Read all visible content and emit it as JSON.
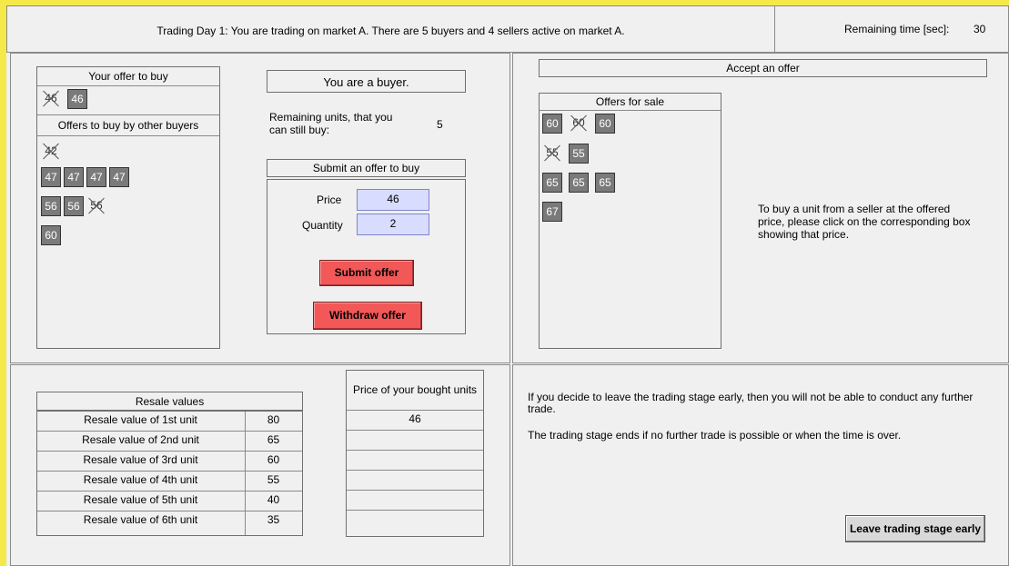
{
  "header": {
    "message": "Trading Day 1: You are trading on market A. There are 5 buyers and 4 sellers active on market A.",
    "remaining_label": "Remaining time [sec]:",
    "remaining_value": "30"
  },
  "buy_panel": {
    "your_offer_title": "Your offer to buy",
    "your_offers": [
      {
        "value": "46",
        "withdrawn": true
      },
      {
        "value": "46",
        "withdrawn": false
      }
    ],
    "other_offers_title": "Offers to buy by other buyers",
    "other_offers_rows": [
      [
        {
          "value": "42",
          "withdrawn": true
        }
      ],
      [
        {
          "value": "47",
          "withdrawn": false
        },
        {
          "value": "47",
          "withdrawn": false
        },
        {
          "value": "47",
          "withdrawn": false
        },
        {
          "value": "47",
          "withdrawn": false
        }
      ],
      [
        {
          "value": "56",
          "withdrawn": false
        },
        {
          "value": "56",
          "withdrawn": false
        },
        {
          "value": "56",
          "withdrawn": true
        }
      ],
      [
        {
          "value": "60",
          "withdrawn": false
        }
      ]
    ]
  },
  "role": {
    "title": "You are a buyer.",
    "remaining_units_label": "Remaining units, that you can still buy:",
    "remaining_units_value": "5"
  },
  "submit": {
    "title": "Submit an offer to buy",
    "price_label": "Price",
    "price_value": "46",
    "quantity_label": "Quantity",
    "quantity_value": "2",
    "submit_label": "Submit offer",
    "withdraw_label": "Withdraw offer"
  },
  "accept": {
    "title": "Accept an offer",
    "offers_title": "Offers for sale",
    "offers_rows": [
      [
        {
          "value": "60",
          "withdrawn": false
        },
        {
          "value": "60",
          "withdrawn": true
        },
        {
          "value": "60",
          "withdrawn": false
        }
      ],
      [
        {
          "value": "55",
          "withdrawn": true
        },
        {
          "value": "55",
          "withdrawn": false
        }
      ],
      [
        {
          "value": "65",
          "withdrawn": false
        },
        {
          "value": "65",
          "withdrawn": false
        },
        {
          "value": "65",
          "withdrawn": false
        }
      ],
      [
        {
          "value": "67",
          "withdrawn": false
        }
      ]
    ],
    "instruction": "To buy a unit from a seller at the offered price, please click on the corresponding box showing that price."
  },
  "resale": {
    "title": "Resale values",
    "rows": [
      {
        "label": "Resale value of 1st unit",
        "value": "80"
      },
      {
        "label": "Resale value of 2nd unit",
        "value": "65"
      },
      {
        "label": "Resale value of 3rd unit",
        "value": "60"
      },
      {
        "label": "Resale value of 4th unit",
        "value": "55"
      },
      {
        "label": "Resale value of 5th unit",
        "value": "40"
      },
      {
        "label": "Resale value of 6th unit",
        "value": "35"
      }
    ]
  },
  "bought": {
    "title": "Price of your bought units",
    "values": [
      "46",
      "",
      "",
      "",
      "",
      ""
    ]
  },
  "leave": {
    "text1": "If you decide to leave the trading stage early, then you will not be able to conduct any further trade.",
    "text2": "The trading stage ends if no further trade is possible or when the time is over.",
    "button_label": "Leave trading stage early"
  }
}
